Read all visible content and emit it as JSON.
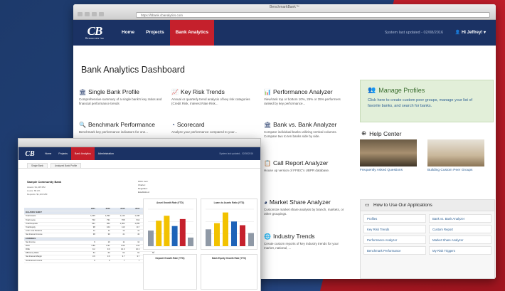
{
  "colors": {
    "navy": "#1b3264",
    "red": "#c5202c",
    "yellow": "#f2c200",
    "blue": "#1e63b8",
    "gray": "#8f99a6",
    "green_panel": "#e2efd9"
  },
  "browser": {
    "window_title": "BenchmarkBank™",
    "url": "https://bbank.cbanalytics.com"
  },
  "app": {
    "logo_text": "CB",
    "logo_sub": "Resources Inc",
    "nav": [
      "Home",
      "Projects",
      "Bank Analytics"
    ],
    "nav_active": "Bank Analytics",
    "status": "System last updated - 02/08/2016",
    "user": "Hi Jeffrey!"
  },
  "dashboard": {
    "title": "Bank Analytics Dashboard",
    "tools": [
      {
        "icon": "bank-icon",
        "title": "Single Bank Profile",
        "desc": "Comprehensive summary of a single bank's key ratios and financial performance trends"
      },
      {
        "icon": "trend-icon",
        "title": "Key Risk Trends",
        "desc": "Annual or quarterly trend analysis of key risk categories (Credit Risk, Interest Rate Risk..."
      },
      {
        "icon": "bar-chart-icon",
        "title": "Performance Analyzer",
        "desc": "View/rank top or bottom 10%, 25% or 35% performers ranked by key performance..."
      },
      {
        "icon": "search-icon",
        "title": "Benchmark Performance",
        "desc": "Benchmark key performance indicators for one..."
      },
      {
        "icon": "scorecard-icon",
        "title": "Scorecard",
        "desc": "Analyze your performance compared to your..."
      },
      {
        "icon": "bank-icon",
        "title": "Bank vs. Bank Analyzer",
        "desc": "Compare individual banks utilizing vertical columns. Compare two to ten banks side by side."
      },
      {
        "icon": "report-icon",
        "title": "Call Report Analyzer",
        "desc": "House up version of FFIEC's UBPR database."
      },
      {
        "icon": "pie-chart-icon",
        "title": "Market Share Analyzer",
        "desc": "Customize market share analysis by branch, markets, or other groupings."
      },
      {
        "icon": "globe-icon",
        "title": "Industry Trends",
        "desc": "Create custom reports of key industry trends for your market, national, ..."
      }
    ],
    "manage": {
      "title": "Manage Profiles",
      "desc": "Click here to create custom peer groups, manage your list of favorite banks, and search for banks."
    },
    "help": {
      "title": "Help Center",
      "items": [
        "Frequently Asked Questions",
        "Building Custom Peer Groups"
      ]
    },
    "howto": {
      "title": "How to Use Our Applications",
      "items": [
        "Profiles",
        "Bank vs. Bank Analyzer",
        "Key Risk Trends",
        "Custom Report",
        "Performance Analyzer",
        "Market Share Analyzer",
        "Benchmark Performance",
        "My Risk Triggers"
      ]
    }
  },
  "laptop": {
    "logo_text": "CB",
    "nav": [
      "Home",
      "Projects",
      "Bank Analytics",
      "Administration"
    ],
    "nav_active": "Bank Analytics",
    "status": "System last updated - 02/08/2016",
    "tabs": [
      "Single Bank",
      "Analyzed Bank Profile"
    ],
    "bank_name": "Sample Community Bank",
    "bank_meta": [
      "Assets: $1,245 MM",
      "Loans: 68.2%",
      "Deposits: $1,104 MM"
    ],
    "info": [
      "FDIC Cert:",
      "Charter:",
      "Regulator:",
      "Established:"
    ],
    "table_header": [
      "",
      "2011",
      "2012",
      "2013",
      "2014",
      "2015"
    ],
    "table_rows": [
      [
        "BALANCE SHEET",
        "",
        "",
        "",
        "",
        ""
      ],
      [
        "Total Assets",
        "1,045",
        "1,092",
        "1,140",
        "1,198",
        "1,245"
      ],
      [
        "Total Loans",
        "702",
        "731",
        "768",
        "812",
        "849"
      ],
      [
        "Total Deposits",
        "921",
        "962",
        "1,004",
        "1,059",
        "1,104"
      ],
      [
        "Total Equity",
        "98",
        "104",
        "110",
        "117",
        "124"
      ],
      [
        "Loan Loss Reserve",
        "11",
        "11",
        "12",
        "12",
        "13"
      ],
      [
        "Net Interest Income",
        "38",
        "39",
        "41",
        "43",
        "45"
      ],
      [
        "EARNINGS",
        "",
        "",
        "",
        "",
        ""
      ],
      [
        "Net Income",
        "9",
        "10",
        "11",
        "12",
        "13"
      ],
      [
        "ROA",
        "0.86",
        "0.91",
        "0.96",
        "1.00",
        "1.04"
      ],
      [
        "ROE",
        "9.2",
        "9.6",
        "10.0",
        "10.3",
        "10.5"
      ],
      [
        "Efficiency Ratio",
        "64",
        "63",
        "62",
        "61",
        "60"
      ],
      [
        "Net Interest Margin",
        "3.6",
        "3.6",
        "3.7",
        "3.7",
        "3.8"
      ],
      [
        "Noninterest Income",
        "6",
        "6",
        "7",
        "7",
        "8"
      ]
    ],
    "charts": [
      {
        "title": "Asset Growth Rate (YTD)",
        "values": [
          3.8,
          6.2,
          7.4,
          4.9,
          6.6,
          2.1
        ]
      },
      {
        "title": "Loans to Assets Ratio (YTD)",
        "values": [
          4.1,
          5.6,
          8.2,
          6.0,
          5.1,
          3.2
        ]
      }
    ],
    "charts_bottom": [
      "Deposit Growth Rate (YTD)",
      "Bank Equity Growth Rate (YTD)"
    ]
  }
}
